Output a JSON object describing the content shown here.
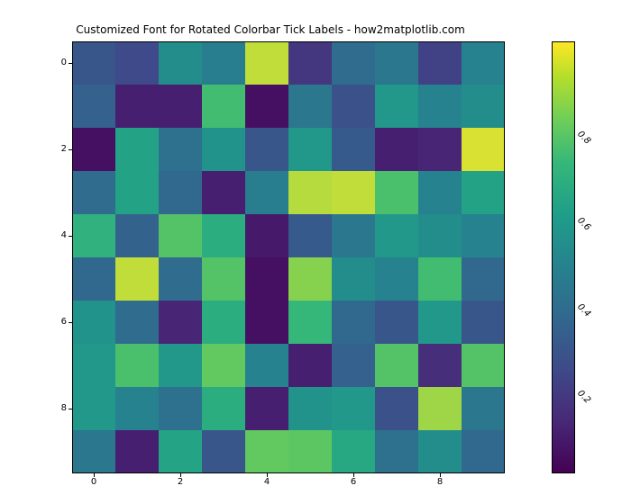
{
  "chart_data": {
    "type": "heatmap",
    "title": "Customized Font for Rotated Colorbar Tick Labels - how2matplotlib.com",
    "xlabel": "",
    "ylabel": "",
    "x_ticks": [
      "0",
      "2",
      "4",
      "6",
      "8"
    ],
    "y_ticks": [
      "0",
      "2",
      "4",
      "6",
      "8"
    ],
    "colorbar_ticks": [
      "0.2",
      "0.4",
      "0.6",
      "0.8"
    ],
    "colormap": "viridis",
    "vmin": 0.0,
    "vmax": 1.0,
    "values": [
      [
        0.3,
        0.25,
        0.55,
        0.48,
        0.95,
        0.18,
        0.4,
        0.45,
        0.22,
        0.5
      ],
      [
        0.35,
        0.1,
        0.1,
        0.78,
        0.05,
        0.45,
        0.28,
        0.6,
        0.5,
        0.55
      ],
      [
        0.05,
        0.65,
        0.42,
        0.58,
        0.3,
        0.6,
        0.32,
        0.1,
        0.12,
        0.97
      ],
      [
        0.4,
        0.65,
        0.38,
        0.1,
        0.48,
        0.94,
        0.95,
        0.8,
        0.5,
        0.65
      ],
      [
        0.72,
        0.36,
        0.82,
        0.7,
        0.08,
        0.32,
        0.45,
        0.6,
        0.55,
        0.5
      ],
      [
        0.38,
        0.95,
        0.4,
        0.82,
        0.05,
        0.9,
        0.55,
        0.5,
        0.78,
        0.38
      ],
      [
        0.58,
        0.4,
        0.12,
        0.7,
        0.05,
        0.75,
        0.38,
        0.3,
        0.6,
        0.3
      ],
      [
        0.6,
        0.8,
        0.6,
        0.85,
        0.5,
        0.1,
        0.35,
        0.82,
        0.15,
        0.82
      ],
      [
        0.6,
        0.5,
        0.42,
        0.7,
        0.1,
        0.58,
        0.6,
        0.28,
        0.92,
        0.45
      ],
      [
        0.45,
        0.1,
        0.66,
        0.3,
        0.85,
        0.84,
        0.68,
        0.42,
        0.55,
        0.38
      ]
    ]
  }
}
